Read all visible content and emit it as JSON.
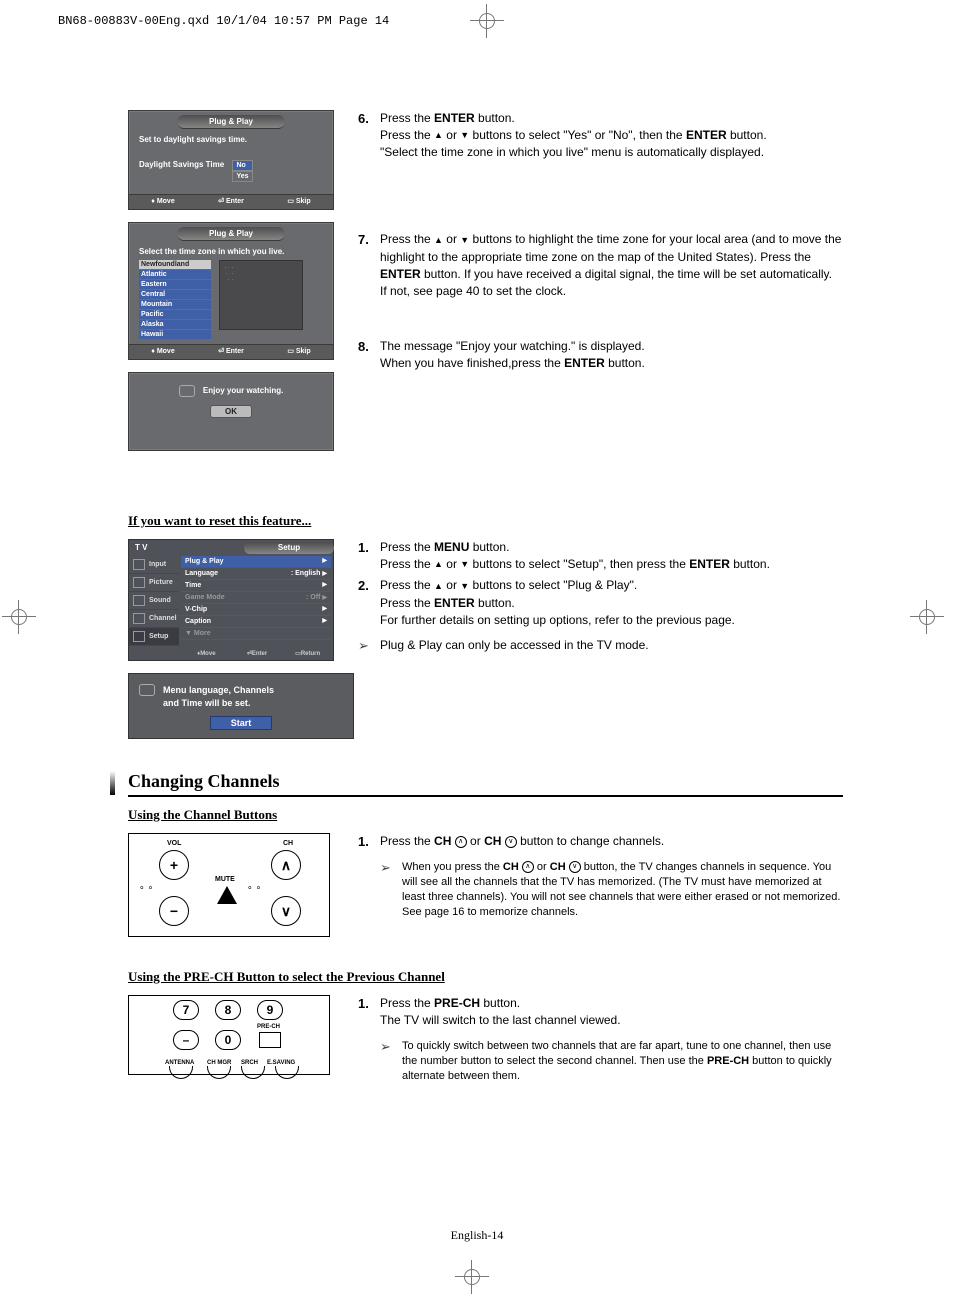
{
  "print_header": "BN68-00883V-00Eng.qxd  10/1/04 10:57 PM  Page 14",
  "footer": "English-14",
  "osd1": {
    "title": "Plug & Play",
    "prompt": "Set to daylight savings time.",
    "label": "Daylight Savings Time",
    "opt_no": "No",
    "opt_yes": "Yes",
    "foot_move": "Move",
    "foot_enter": "Enter",
    "foot_skip": "Skip"
  },
  "osd2": {
    "title": "Plug & Play",
    "prompt": "Select the time zone in which you live.",
    "tz": [
      "Newfoundland",
      "Atlantic",
      "Eastern",
      "Central",
      "Mountain",
      "Pacific",
      "Alaska",
      "Hawaii"
    ],
    "foot_move": "Move",
    "foot_enter": "Enter",
    "foot_skip": "Skip"
  },
  "osd3": {
    "msg": "Enjoy your watching.",
    "ok": "OK"
  },
  "osd4": {
    "tv": "T V",
    "title": "Setup",
    "side": [
      "Input",
      "Picture",
      "Sound",
      "Channel",
      "Setup"
    ],
    "rows": [
      {
        "label": "Plug & Play",
        "val": "",
        "hl": true
      },
      {
        "label": "Language",
        "val": ": English"
      },
      {
        "label": "Time",
        "val": ""
      },
      {
        "label": "Game Mode",
        "val": ": Off",
        "dim": true
      },
      {
        "label": "V-Chip",
        "val": ""
      },
      {
        "label": "Caption",
        "val": ""
      },
      {
        "label": "▼  More",
        "val": "",
        "dim": true
      }
    ],
    "foot_move": "Move",
    "foot_enter": "Enter",
    "foot_return": "Return"
  },
  "osd5": {
    "line1": "Menu language, Channels",
    "line2": "and Time will be set.",
    "start": "Start"
  },
  "steps": {
    "s6_a": "Press the ",
    "s6_b": "ENTER",
    "s6_c": " button.",
    "s6_d": "Press the ",
    "s6_e": " or ",
    "s6_f": " buttons to select \"Yes\" or \"No\", then the ",
    "s6_g": "ENTER",
    "s6_h": " button.",
    "s6_i": "\"Select the time zone in which you live\" menu is automatically displayed.",
    "s7_a": "Press the ",
    "s7_b": " or ",
    "s7_c": " buttons to highlight the time zone for your local area (and to move the highlight to the appropriate time zone on the map of the United States). Press the ",
    "s7_d": "ENTER",
    "s7_e": " button. If you have received a digital signal, the time will be set automatically.",
    "s7_f": "If not, see page 40 to set the clock.",
    "s8_a": "The message \"Enjoy your watching.\" is displayed.",
    "s8_b": "When you have finished,press the ",
    "s8_c": "ENTER",
    "s8_d": " button."
  },
  "reset_head": "If you want to reset this feature...",
  "reset_steps": {
    "r1_a": "Press the ",
    "r1_b": "MENU",
    "r1_c": " button.",
    "r1_d": "Press the ",
    "r1_e": " or ",
    "r1_f": " buttons to select \"Setup\", then press the ",
    "r1_g": "ENTER",
    "r1_h": " button.",
    "r2_a": "Press the ",
    "r2_b": " or ",
    "r2_c": " buttons to select \"Plug & Play\".",
    "r2_d": "Press the ",
    "r2_e": "ENTER",
    "r2_f": " button.",
    "r2_g": "For further details on setting up options, refer to the previous page.",
    "note": "Plug & Play can only be accessed in the TV mode."
  },
  "section2": "Changing Channels",
  "sub_cb": "Using the Channel Buttons",
  "sub_cb_step": {
    "a": "Press the ",
    "b": "CH",
    "c": " or ",
    "d": "CH",
    "e": " button to change channels.",
    "note_a": "When you press the ",
    "note_b": "CH",
    "note_c": " or ",
    "note_d": "CH",
    "note_e": " button, the TV changes channels in sequence. You will see all the channels that the TV has memorized. (The TV must have memorized at least three channels). You will not see channels that were either erased or not memorized. See page 16 to memorize channels."
  },
  "sub_pre": "Using the PRE-CH Button to select the Previous Channel",
  "pre_step": {
    "a": "Press the ",
    "b": "PRE-CH",
    "c": " button.",
    "d": "The TV will switch to the last channel viewed.",
    "note_a": "To quickly switch between two channels that are far apart, tune to one channel, then use the number button to select the second channel. Then use the ",
    "note_b": "PRE-CH",
    "note_c": " button to quickly alternate between them."
  },
  "remote": {
    "vol": "VOL",
    "ch": "CH",
    "mute": "MUTE"
  },
  "remote2": {
    "n7": "7",
    "n8": "8",
    "n9": "9",
    "n0": "0",
    "dash": "–",
    "prech": "PRE-CH",
    "antenna": "ANTENNA",
    "chmgr": "CH MGR",
    "srch": "SRCH",
    "esaving": "E.SAVING"
  }
}
